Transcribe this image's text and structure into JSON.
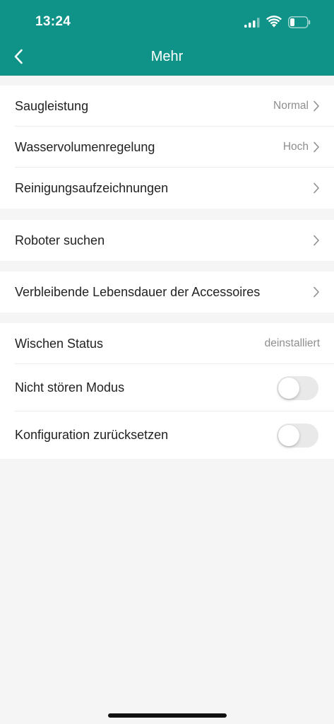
{
  "status_bar": {
    "time": "13:24",
    "signal_icon": "cellular-signal-icon",
    "wifi_icon": "wifi-icon",
    "battery_icon": "battery-low-icon"
  },
  "nav": {
    "back_icon": "chevron-left-icon",
    "title": "Mehr"
  },
  "colors": {
    "header": "#0f9388",
    "background": "#f5f5f5",
    "row_text": "#222222",
    "value_text": "#8e8e8e",
    "toggle_off": "#e9e9ea"
  },
  "groups": [
    {
      "rows": [
        {
          "label": "Saugleistung",
          "value": "Normal",
          "chevron": true
        },
        {
          "label": "Wasservolumenregelung",
          "value": "Hoch",
          "chevron": true
        },
        {
          "label": "Reinigungsaufzeichnungen",
          "value": "",
          "chevron": true
        }
      ]
    },
    {
      "rows": [
        {
          "label": "Roboter suchen",
          "value": "",
          "chevron": true
        }
      ]
    },
    {
      "rows": [
        {
          "label": "Verbleibende Lebensdauer der Accessoires",
          "value": "",
          "chevron": true
        }
      ]
    },
    {
      "rows": [
        {
          "label": "Wischen Status",
          "value": "deinstalliert"
        },
        {
          "label": "Nicht stören Modus",
          "toggle": false
        },
        {
          "label": "Konfiguration zurücksetzen",
          "toggle": false
        }
      ]
    }
  ]
}
